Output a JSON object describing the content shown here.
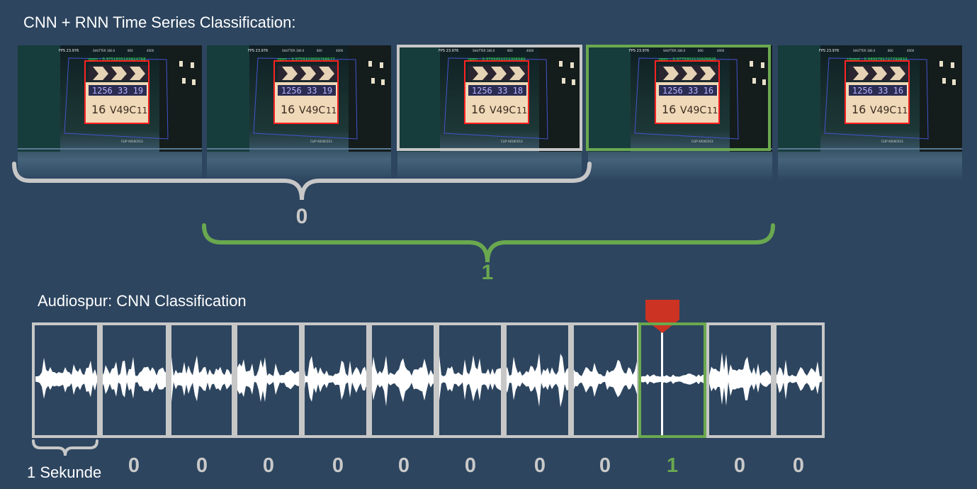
{
  "title": "CNN + RNN Time Series Classification:",
  "frames": [
    {
      "timecode": "12563319",
      "tc_display": "1256 33 19",
      "roll": "16",
      "scene": "V49C",
      "take": "11",
      "fps": "FPS 23.976",
      "shutter": "SHUTTER 180.0",
      "iso": "800",
      "wb": "4000",
      "clip": "CLIP A016C013",
      "detection": "open – 0.9751835193824768"
    },
    {
      "timecode": "12563319",
      "tc_display": "1256 33 19",
      "roll": "16",
      "scene": "V49C",
      "take": "11",
      "fps": "FPS 23.976",
      "shutter": "SHUTTER 180.0",
      "iso": "800",
      "wb": "4000",
      "clip": "CLIP A016C013",
      "detection": "open – 0.9759103059768677"
    },
    {
      "timecode": "12563318",
      "tc_display": "1256 33 18",
      "roll": "16",
      "scene": "V49C",
      "take": "11",
      "fps": "FPS 23.976",
      "shutter": "SHUTTER 180.0",
      "iso": "800",
      "wb": "4000",
      "clip": "CLIP A016C013",
      "detection": "open – 0.9769491553306580"
    },
    {
      "timecode": "12563316",
      "tc_display": "1256 33 16",
      "roll": "16",
      "scene": "V49C",
      "take": "11",
      "fps": "FPS 23.976",
      "shutter": "SHUTTER 180.0",
      "iso": "800",
      "wb": "4000",
      "clip": "CLIP A016C013",
      "detection": "open – 0.9770902132606826"
    },
    {
      "timecode": "12563316",
      "tc_display": "1256 33 16",
      "roll": "16",
      "scene": "V49C",
      "take": "11",
      "fps": "FPS 23.976",
      "shutter": "SHUTTER 180.0",
      "iso": "800",
      "wb": "4000",
      "clip": "CLIP A016C013",
      "detection": "closed – 0.9499781727790833"
    }
  ],
  "sequence_labels": {
    "first": "0",
    "second": "1"
  },
  "audio_title": "Audiospur: CNN Classification",
  "audio_labels": [
    "0",
    "0",
    "0",
    "0",
    "0",
    "0",
    "0",
    "0",
    "1",
    "0",
    "0"
  ],
  "second_label": "1 Sekunde",
  "colors": {
    "background": "#2d455f",
    "neutral": "#c7c7c7",
    "highlight": "#6aa84f",
    "marker": "#cc3322",
    "detection": "#ff2222",
    "bbox": "#4455cc"
  }
}
